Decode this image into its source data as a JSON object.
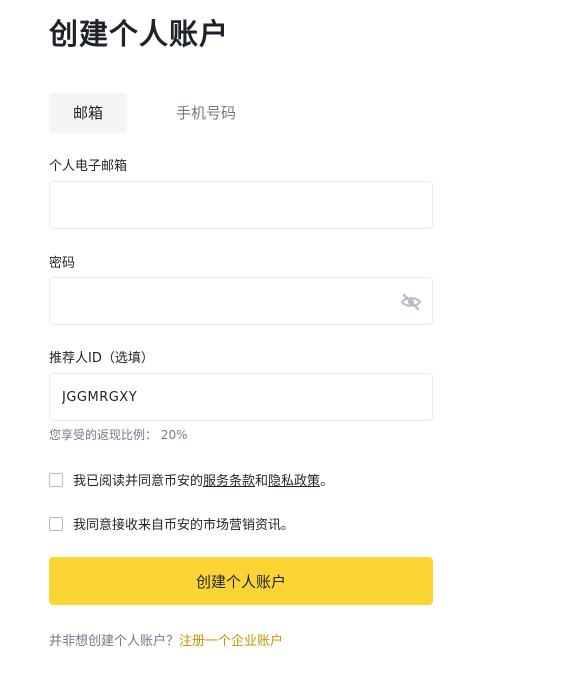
{
  "page_title": "创建个人账户",
  "tabs": [
    {
      "label": "邮箱",
      "active": true
    },
    {
      "label": "手机号码",
      "active": false
    }
  ],
  "email": {
    "label": "个人电子邮箱",
    "value": ""
  },
  "password": {
    "label": "密码",
    "value": "",
    "icon": "eye-slash-icon"
  },
  "referral": {
    "label": "推荐人ID（选填）",
    "value": "JGGMRGXY"
  },
  "commission_hint": "您享受的返现比例： 20%",
  "terms": {
    "prefix": "我已阅读并同意币安的",
    "terms_link": "服务条款",
    "conjunction": "和",
    "privacy_link": "隐私政策",
    "suffix": "。",
    "checked": false
  },
  "marketing": {
    "label": "我同意接收来自币安的市场营销资讯。",
    "checked": false
  },
  "submit_label": "创建个人账户",
  "footer": {
    "question": "并非想创建个人账户？",
    "link": "注册一个企业账户"
  },
  "colors": {
    "primary": "#fcd535",
    "link": "#c99400",
    "text": "#1e2329",
    "muted": "#707a8a",
    "border": "#eaecef"
  }
}
